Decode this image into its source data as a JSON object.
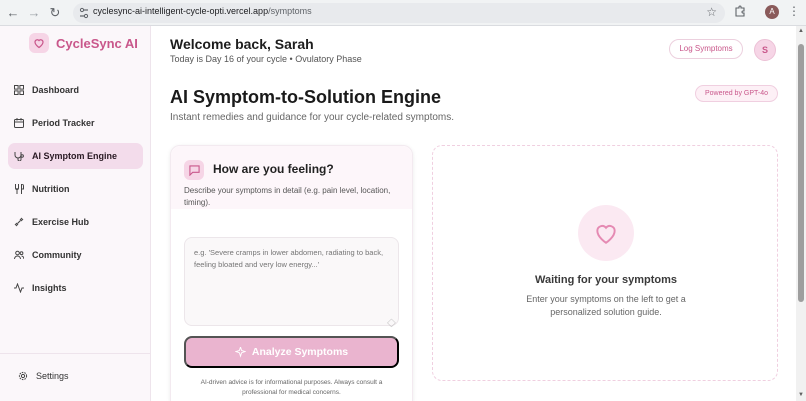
{
  "browser": {
    "url_host": "cyclesync-ai-intelligent-cycle-opti.vercel.app",
    "url_path": "/symptoms",
    "profile_initial": "A",
    "icons": [
      "back-icon",
      "forward-icon",
      "reload-icon",
      "site-settings-icon",
      "bookmark-star-icon",
      "extensions-icon",
      "more-menu-icon"
    ]
  },
  "sidebar": {
    "brand": "CycleSync AI",
    "items": [
      {
        "label": "Dashboard",
        "icon": "dashboard-icon"
      },
      {
        "label": "Period Tracker",
        "icon": "calendar-icon"
      },
      {
        "label": "AI Symptom Engine",
        "icon": "symptom-engine-icon",
        "active": true
      },
      {
        "label": "Nutrition",
        "icon": "utensils-icon"
      },
      {
        "label": "Exercise Hub",
        "icon": "dumbbell-icon"
      },
      {
        "label": "Community",
        "icon": "users-icon"
      },
      {
        "label": "Insights",
        "icon": "activity-icon"
      }
    ],
    "settings_label": "Settings"
  },
  "header": {
    "welcome": "Welcome back, Sarah",
    "cycle_status": "Today is Day 16 of your cycle • Ovulatory Phase",
    "log_button": "Log Symptoms",
    "user_initial": "S"
  },
  "page": {
    "title": "AI Symptom-to-Solution Engine",
    "subtitle": "Instant remedies and guidance for your cycle-related symptoms.",
    "powered_badge": "Powered by GPT-4o"
  },
  "input_card": {
    "title": "How are you feeling?",
    "description": "Describe your symptoms in detail (e.g. pain level, location, timing).",
    "placeholder": "e.g. 'Severe cramps in lower abdomen, radiating to back, feeling bloated and very low energy...'",
    "value": "",
    "analyze_button": "Analyze Symptoms",
    "disclaimer": "AI-driven advice is for informational purposes. Always consult a professional for medical concerns."
  },
  "result_panel": {
    "title": "Waiting for your symptoms",
    "subtitle": "Enter your symptoms on the left to get a personalized solution guide."
  },
  "colors": {
    "brand_pink": "#c9578b",
    "soft_pink": "#f6d5e6",
    "button_pink": "#eab4cf",
    "active_nav_bg": "#f3dceb"
  }
}
